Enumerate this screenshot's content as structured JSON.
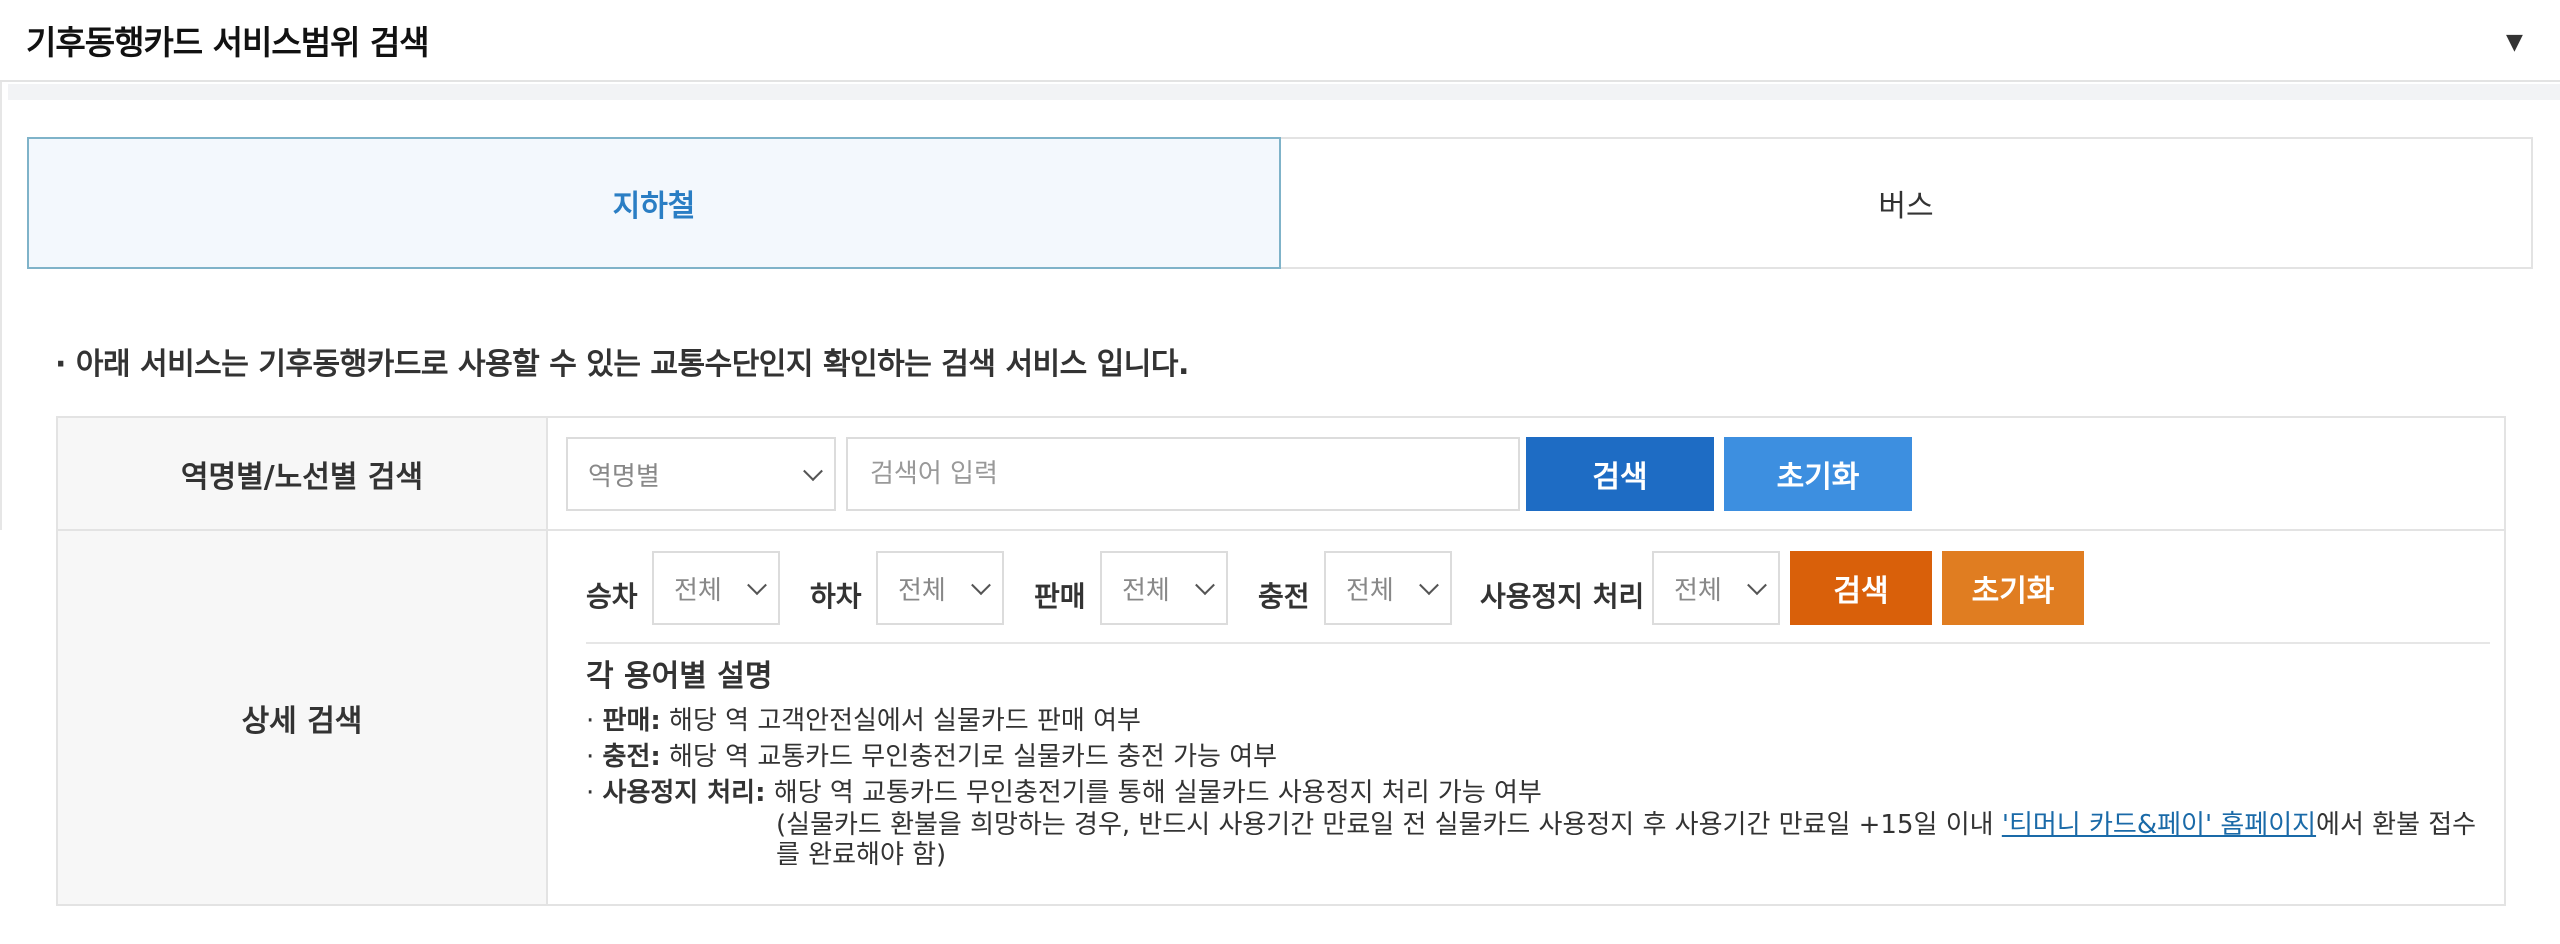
{
  "header": {
    "title": "기후동행카드 서비스범위 검색"
  },
  "tabs": [
    {
      "label": "지하철"
    },
    {
      "label": "버스"
    }
  ],
  "intro": "· 아래 서비스는 기후동행카드로 사용할 수 있는 교통수단인지 확인하는 검색 서비스 입니다.",
  "basic_search": {
    "label": "역명별/노선별 검색",
    "select_value": "역명별",
    "input_placeholder": "검색어 입력",
    "search_label": "검색",
    "reset_label": "초기화"
  },
  "detail_search": {
    "label": "상세 검색",
    "filters": [
      {
        "label": "승차",
        "value": "전체"
      },
      {
        "label": "하차",
        "value": "전체"
      },
      {
        "label": "판매",
        "value": "전체"
      },
      {
        "label": "충전",
        "value": "전체"
      },
      {
        "label": "사용정지 처리",
        "value": "전체"
      }
    ],
    "search_label": "검색",
    "reset_label": "초기화"
  },
  "glossary": {
    "title": "각 용어별 설명",
    "items": [
      {
        "bullet": "· ",
        "term": "판매:",
        "desc": " 해당 역 고객안전실에서 실물카드 판매 여부"
      },
      {
        "bullet": "· ",
        "term": "충전:",
        "desc": " 해당 역 교통카드 무인충전기로 실물카드 충전 가능 여부"
      },
      {
        "bullet": "· ",
        "term": "사용정지 처리:",
        "desc": " 해당 역 교통카드 무인충전기를 통해 실물카드 사용정지 처리 가능 여부"
      }
    ],
    "note_before": "(실물카드 환불을 희망하는 경우, 반드시 사용기간 만료일 전 실물카드 사용정지 후 사용기간 만료일 +15일 이내 ",
    "note_link": "'티머니 카드&페이' 홈페이지",
    "note_after": "에서 환불 접수를 완료해야 함)"
  },
  "colors": {
    "accent_blue": "#1e6cc4",
    "accent_blue_light": "#3d8fe0",
    "accent_orange": "#d9600a",
    "accent_orange_light": "#e07d21",
    "active_tab_text": "#2a7ec4"
  }
}
